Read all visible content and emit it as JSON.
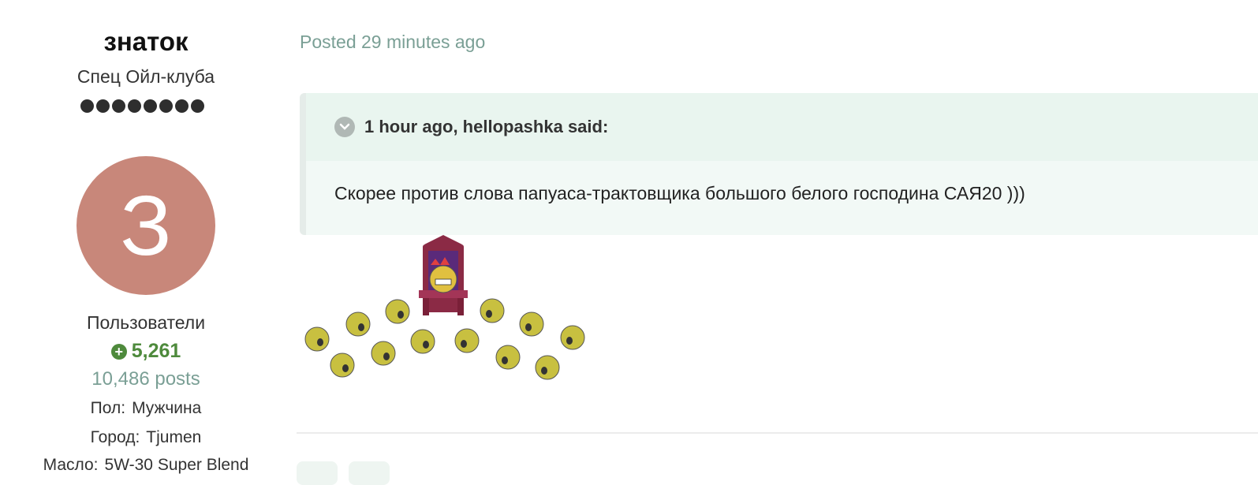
{
  "author": {
    "name": "знаток",
    "rank_title": "Спец Ойл-клуба",
    "rank_pips": 8,
    "avatar_letter": "З",
    "avatar_color": "#c8877a",
    "group": "Пользователи",
    "reputation": "5,261",
    "posts": "10,486 posts",
    "fields": [
      {
        "key": "Пол:",
        "value": "Мужчина"
      },
      {
        "key": "Город:",
        "value": "Tjumen"
      },
      {
        "key": "Масло:",
        "value": "5W-30 Super Blend"
      }
    ]
  },
  "post": {
    "posted": "Posted 29 minutes ago",
    "quote": {
      "citation": "1 hour ago, hellopashka said:",
      "text": "Скорее против слова папуаса-трактовщика большого белого господина САЯ20 )))"
    },
    "smiley_icon": "king-on-throne-with-worshippers-smiley"
  },
  "colors": {
    "accent_green": "#4e8a3c",
    "muted_teal": "#7a9f95",
    "quote_bg": "#f2f9f6"
  }
}
